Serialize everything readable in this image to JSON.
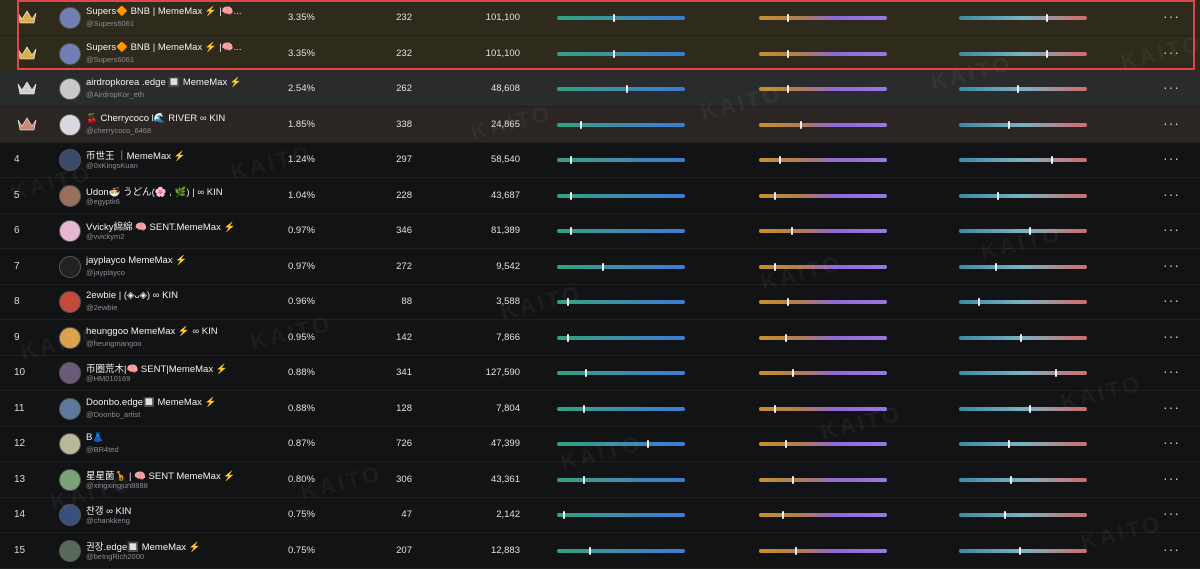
{
  "watermark": "KAITO",
  "rows": [
    {
      "rank": "",
      "crown": "gold",
      "name": "Supers🔶 BNB | MemeMax ⚡ |🧠...",
      "handle": "@Supers6061",
      "pct": "3.35%",
      "count": "232",
      "impressions": "101,100",
      "bars": [
        0.44,
        0.22,
        0.68
      ],
      "avatar": "#6f7fb3",
      "style": "hl"
    },
    {
      "rank": "",
      "crown": "gold",
      "name": "Supers🔶 BNB | MemeMax ⚡ |🧠...",
      "handle": "@Supers6061",
      "pct": "3.35%",
      "count": "232",
      "impressions": "101,100",
      "bars": [
        0.44,
        0.22,
        0.68
      ],
      "avatar": "#6f7fb3",
      "style": "hl"
    },
    {
      "rank": "",
      "crown": "silver",
      "name": "airdropkorea .edge 🔲 MemeMax ⚡",
      "handle": "@AirdropKor_eth",
      "pct": "2.54%",
      "count": "262",
      "impressions": "48,608",
      "bars": [
        0.54,
        0.22,
        0.45
      ],
      "avatar": "#c9c9cc",
      "style": "r2"
    },
    {
      "rank": "",
      "crown": "bronze",
      "name": "🍒 Cherrycoco l🌊 RIVER ∞ KIN",
      "handle": "@cherrycoco_6468",
      "pct": "1.85%",
      "count": "338",
      "impressions": "24,865",
      "bars": [
        0.18,
        0.32,
        0.38
      ],
      "avatar": "#d8d8de",
      "style": "r3"
    },
    {
      "rank": "4",
      "crown": "",
      "name": "币世王 ｜MemeMax ⚡",
      "handle": "@0xKingsKuan",
      "pct": "1.24%",
      "count": "297",
      "impressions": "58,540",
      "bars": [
        0.1,
        0.16,
        0.72
      ],
      "avatar": "#3a4a6a",
      "style": ""
    },
    {
      "rank": "5",
      "crown": "",
      "name": "Udon🍜 うどん(🌸 , 🌿) | ∞ KIN",
      "handle": "@egyptk6",
      "pct": "1.04%",
      "count": "228",
      "impressions": "43,687",
      "bars": [
        0.1,
        0.12,
        0.3
      ],
      "avatar": "#9a6f5c",
      "style": ""
    },
    {
      "rank": "6",
      "crown": "",
      "name": "Vvicky綿綿 🧠 SENT.MemeMax ⚡",
      "handle": "@vvickym2",
      "pct": "0.97%",
      "count": "346",
      "impressions": "81,389",
      "bars": [
        0.1,
        0.25,
        0.55
      ],
      "avatar": "#e7b6d0",
      "style": ""
    },
    {
      "rank": "7",
      "crown": "",
      "name": "jayplayco MemeMax ⚡",
      "handle": "@jayplayco",
      "pct": "0.97%",
      "count": "272",
      "impressions": "9,542",
      "bars": [
        0.35,
        0.12,
        0.28
      ],
      "avatar": "#222",
      "style": ""
    },
    {
      "rank": "8",
      "crown": "",
      "name": "2ewbie | (◈ᴗ◈) ∞ KIN",
      "handle": "@2ewbie",
      "pct": "0.96%",
      "count": "88",
      "impressions": "3,588",
      "bars": [
        0.08,
        0.22,
        0.15
      ],
      "avatar": "#c34a3a",
      "style": ""
    },
    {
      "rank": "9",
      "crown": "",
      "name": "heunggoo MemeMax ⚡ ∞ KIN",
      "handle": "@heungmangoo",
      "pct": "0.95%",
      "count": "142",
      "impressions": "7,866",
      "bars": [
        0.08,
        0.2,
        0.48
      ],
      "avatar": "#d9a24a",
      "style": ""
    },
    {
      "rank": "10",
      "crown": "",
      "name": "币圈荒木|🧠 SENT|MemeMax ⚡",
      "handle": "@HM010169",
      "pct": "0.88%",
      "count": "341",
      "impressions": "127,590",
      "bars": [
        0.22,
        0.26,
        0.75
      ],
      "avatar": "#6a5a7a",
      "style": ""
    },
    {
      "rank": "11",
      "crown": "",
      "name": "Doonbo.edge🔲 MemeMax ⚡",
      "handle": "@Doonbo_artist",
      "pct": "0.88%",
      "count": "128",
      "impressions": "7,804",
      "bars": [
        0.2,
        0.12,
        0.55
      ],
      "avatar": "#5d7a9a",
      "style": ""
    },
    {
      "rank": "12",
      "crown": "",
      "name": "B👗",
      "handle": "@BR4ted",
      "pct": "0.87%",
      "count": "726",
      "impressions": "47,399",
      "bars": [
        0.7,
        0.2,
        0.38
      ],
      "avatar": "#b9b99a",
      "style": ""
    },
    {
      "rank": "13",
      "crown": "",
      "name": "星星菌🦒 | 🧠 SENT MemeMax ⚡",
      "handle": "@xingxingjun8888",
      "pct": "0.80%",
      "count": "306",
      "impressions": "43,361",
      "bars": [
        0.2,
        0.26,
        0.4
      ],
      "avatar": "#7aa37a",
      "style": ""
    },
    {
      "rank": "14",
      "crown": "",
      "name": "찬갱 ∞ KIN",
      "handle": "@chankkeng",
      "pct": "0.75%",
      "count": "47",
      "impressions": "2,142",
      "bars": [
        0.05,
        0.18,
        0.35
      ],
      "avatar": "#3a4f7a",
      "style": ""
    },
    {
      "rank": "15",
      "crown": "",
      "name": "권장.edge🔲 MemeMax ⚡",
      "handle": "@beIngRich2000",
      "pct": "0.75%",
      "count": "207",
      "impressions": "12,883",
      "bars": [
        0.25,
        0.28,
        0.47
      ],
      "avatar": "#5a6a5a",
      "style": ""
    }
  ],
  "more_label": "···",
  "colors": {
    "gold": "#d8b04a",
    "silver": "#cfcfcf",
    "bronze": "#c98a70",
    "selection": "#e0474c"
  }
}
